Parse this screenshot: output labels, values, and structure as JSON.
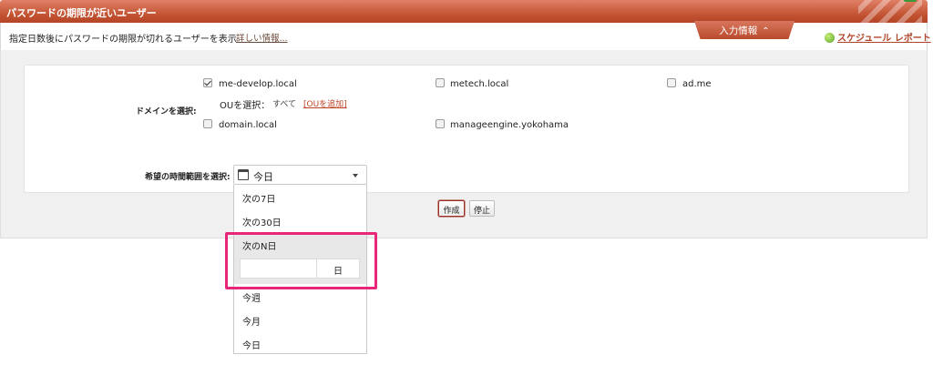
{
  "header": {
    "title": "パスワードの期限が近いユーザー"
  },
  "description": {
    "text": "指定日数後にパスワードの期限が切れるユーザーを表示",
    "detail_link": "詳しい情報..."
  },
  "input_tab": {
    "label": "入力情報"
  },
  "schedule_link": {
    "label": "スケジュール レポート"
  },
  "domain_section": {
    "label": "ドメインを選択:",
    "domains": [
      {
        "name": "me-develop.local",
        "checked": true
      },
      {
        "name": "metech.local",
        "checked": false
      },
      {
        "name": "ad.me",
        "checked": false
      },
      {
        "name": "domain.local",
        "checked": false
      },
      {
        "name": "manageengine.yokohama",
        "checked": false
      }
    ],
    "ou": {
      "label": "OUを選択：",
      "value": "すべて",
      "add_link": "[OUを追加]"
    }
  },
  "time_range": {
    "label": "希望の時間範囲を選択:",
    "selected": "今日",
    "options": [
      "次の7日",
      "次の30日",
      "次のN日",
      "今週",
      "今月",
      "今日"
    ],
    "n_days_unit": "日"
  },
  "buttons": {
    "create": "作成",
    "stop": "停止"
  },
  "colors": {
    "header": "#c0502f",
    "highlight": "#e8267a",
    "link": "#c0442a"
  }
}
